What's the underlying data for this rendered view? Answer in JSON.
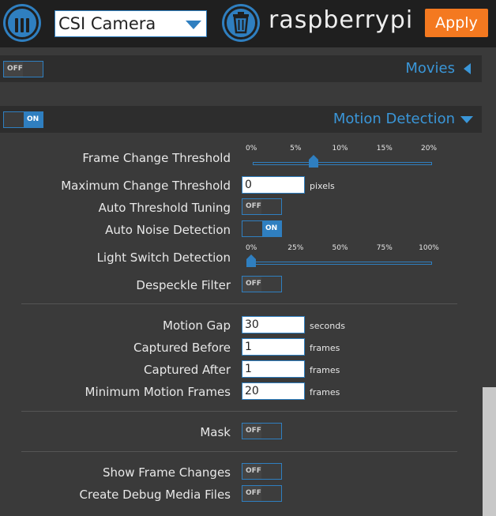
{
  "header": {
    "camera_select_value": "CSI Camera",
    "host_name": "raspberrypi",
    "apply_label": "Apply"
  },
  "movies": {
    "title": "Movies",
    "toggle_label": "OFF",
    "enabled": false
  },
  "motion": {
    "title": "Motion Detection",
    "toggle_label": "ON",
    "enabled": true,
    "frame_change_threshold": {
      "label": "Frame Change Threshold",
      "ticks": [
        "0%",
        "5%",
        "10%",
        "15%",
        "20%"
      ],
      "value_fraction": 0.35
    },
    "max_change_threshold": {
      "label": "Maximum Change Threshold",
      "value": "0",
      "unit": "pixels"
    },
    "auto_threshold_tuning": {
      "label": "Auto Threshold Tuning",
      "toggle_label": "OFF",
      "enabled": false
    },
    "auto_noise_detection": {
      "label": "Auto Noise Detection",
      "toggle_label": "ON",
      "enabled": true
    },
    "light_switch_detection": {
      "label": "Light Switch Detection",
      "ticks": [
        "0%",
        "25%",
        "50%",
        "75%",
        "100%"
      ],
      "value_fraction": 0.0
    },
    "despeckle_filter": {
      "label": "Despeckle Filter",
      "toggle_label": "OFF",
      "enabled": false
    },
    "motion_gap": {
      "label": "Motion Gap",
      "value": "30",
      "unit": "seconds"
    },
    "captured_before": {
      "label": "Captured Before",
      "value": "1",
      "unit": "frames"
    },
    "captured_after": {
      "label": "Captured After",
      "value": "1",
      "unit": "frames"
    },
    "minimum_motion_frames": {
      "label": "Minimum Motion Frames",
      "value": "20",
      "unit": "frames"
    },
    "mask": {
      "label": "Mask",
      "toggle_label": "OFF",
      "enabled": false
    },
    "show_frame_changes": {
      "label": "Show Frame Changes",
      "toggle_label": "OFF",
      "enabled": false
    },
    "create_debug_media_files": {
      "label": "Create Debug Media Files",
      "toggle_label": "OFF",
      "enabled": false
    }
  },
  "colors": {
    "accent": "#2f7fc0",
    "accent_text": "#3a96d8",
    "apply": "#f47920",
    "background": "#3a3a3a",
    "topbar": "#1f1f1f"
  }
}
